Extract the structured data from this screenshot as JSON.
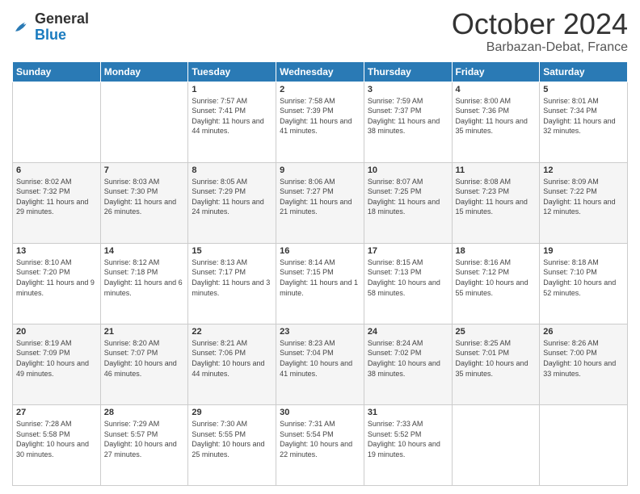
{
  "header": {
    "logo": {
      "general": "General",
      "blue": "Blue"
    },
    "title": "October 2024",
    "location": "Barbazan-Debat, France"
  },
  "weekdays": [
    "Sunday",
    "Monday",
    "Tuesday",
    "Wednesday",
    "Thursday",
    "Friday",
    "Saturday"
  ],
  "weeks": [
    [
      {
        "day": "",
        "sunrise": "",
        "sunset": "",
        "daylight": ""
      },
      {
        "day": "",
        "sunrise": "",
        "sunset": "",
        "daylight": ""
      },
      {
        "day": "1",
        "sunrise": "Sunrise: 7:57 AM",
        "sunset": "Sunset: 7:41 PM",
        "daylight": "Daylight: 11 hours and 44 minutes."
      },
      {
        "day": "2",
        "sunrise": "Sunrise: 7:58 AM",
        "sunset": "Sunset: 7:39 PM",
        "daylight": "Daylight: 11 hours and 41 minutes."
      },
      {
        "day": "3",
        "sunrise": "Sunrise: 7:59 AM",
        "sunset": "Sunset: 7:37 PM",
        "daylight": "Daylight: 11 hours and 38 minutes."
      },
      {
        "day": "4",
        "sunrise": "Sunrise: 8:00 AM",
        "sunset": "Sunset: 7:36 PM",
        "daylight": "Daylight: 11 hours and 35 minutes."
      },
      {
        "day": "5",
        "sunrise": "Sunrise: 8:01 AM",
        "sunset": "Sunset: 7:34 PM",
        "daylight": "Daylight: 11 hours and 32 minutes."
      }
    ],
    [
      {
        "day": "6",
        "sunrise": "Sunrise: 8:02 AM",
        "sunset": "Sunset: 7:32 PM",
        "daylight": "Daylight: 11 hours and 29 minutes."
      },
      {
        "day": "7",
        "sunrise": "Sunrise: 8:03 AM",
        "sunset": "Sunset: 7:30 PM",
        "daylight": "Daylight: 11 hours and 26 minutes."
      },
      {
        "day": "8",
        "sunrise": "Sunrise: 8:05 AM",
        "sunset": "Sunset: 7:29 PM",
        "daylight": "Daylight: 11 hours and 24 minutes."
      },
      {
        "day": "9",
        "sunrise": "Sunrise: 8:06 AM",
        "sunset": "Sunset: 7:27 PM",
        "daylight": "Daylight: 11 hours and 21 minutes."
      },
      {
        "day": "10",
        "sunrise": "Sunrise: 8:07 AM",
        "sunset": "Sunset: 7:25 PM",
        "daylight": "Daylight: 11 hours and 18 minutes."
      },
      {
        "day": "11",
        "sunrise": "Sunrise: 8:08 AM",
        "sunset": "Sunset: 7:23 PM",
        "daylight": "Daylight: 11 hours and 15 minutes."
      },
      {
        "day": "12",
        "sunrise": "Sunrise: 8:09 AM",
        "sunset": "Sunset: 7:22 PM",
        "daylight": "Daylight: 11 hours and 12 minutes."
      }
    ],
    [
      {
        "day": "13",
        "sunrise": "Sunrise: 8:10 AM",
        "sunset": "Sunset: 7:20 PM",
        "daylight": "Daylight: 11 hours and 9 minutes."
      },
      {
        "day": "14",
        "sunrise": "Sunrise: 8:12 AM",
        "sunset": "Sunset: 7:18 PM",
        "daylight": "Daylight: 11 hours and 6 minutes."
      },
      {
        "day": "15",
        "sunrise": "Sunrise: 8:13 AM",
        "sunset": "Sunset: 7:17 PM",
        "daylight": "Daylight: 11 hours and 3 minutes."
      },
      {
        "day": "16",
        "sunrise": "Sunrise: 8:14 AM",
        "sunset": "Sunset: 7:15 PM",
        "daylight": "Daylight: 11 hours and 1 minute."
      },
      {
        "day": "17",
        "sunrise": "Sunrise: 8:15 AM",
        "sunset": "Sunset: 7:13 PM",
        "daylight": "Daylight: 10 hours and 58 minutes."
      },
      {
        "day": "18",
        "sunrise": "Sunrise: 8:16 AM",
        "sunset": "Sunset: 7:12 PM",
        "daylight": "Daylight: 10 hours and 55 minutes."
      },
      {
        "day": "19",
        "sunrise": "Sunrise: 8:18 AM",
        "sunset": "Sunset: 7:10 PM",
        "daylight": "Daylight: 10 hours and 52 minutes."
      }
    ],
    [
      {
        "day": "20",
        "sunrise": "Sunrise: 8:19 AM",
        "sunset": "Sunset: 7:09 PM",
        "daylight": "Daylight: 10 hours and 49 minutes."
      },
      {
        "day": "21",
        "sunrise": "Sunrise: 8:20 AM",
        "sunset": "Sunset: 7:07 PM",
        "daylight": "Daylight: 10 hours and 46 minutes."
      },
      {
        "day": "22",
        "sunrise": "Sunrise: 8:21 AM",
        "sunset": "Sunset: 7:06 PM",
        "daylight": "Daylight: 10 hours and 44 minutes."
      },
      {
        "day": "23",
        "sunrise": "Sunrise: 8:23 AM",
        "sunset": "Sunset: 7:04 PM",
        "daylight": "Daylight: 10 hours and 41 minutes."
      },
      {
        "day": "24",
        "sunrise": "Sunrise: 8:24 AM",
        "sunset": "Sunset: 7:02 PM",
        "daylight": "Daylight: 10 hours and 38 minutes."
      },
      {
        "day": "25",
        "sunrise": "Sunrise: 8:25 AM",
        "sunset": "Sunset: 7:01 PM",
        "daylight": "Daylight: 10 hours and 35 minutes."
      },
      {
        "day": "26",
        "sunrise": "Sunrise: 8:26 AM",
        "sunset": "Sunset: 7:00 PM",
        "daylight": "Daylight: 10 hours and 33 minutes."
      }
    ],
    [
      {
        "day": "27",
        "sunrise": "Sunrise: 7:28 AM",
        "sunset": "Sunset: 5:58 PM",
        "daylight": "Daylight: 10 hours and 30 minutes."
      },
      {
        "day": "28",
        "sunrise": "Sunrise: 7:29 AM",
        "sunset": "Sunset: 5:57 PM",
        "daylight": "Daylight: 10 hours and 27 minutes."
      },
      {
        "day": "29",
        "sunrise": "Sunrise: 7:30 AM",
        "sunset": "Sunset: 5:55 PM",
        "daylight": "Daylight: 10 hours and 25 minutes."
      },
      {
        "day": "30",
        "sunrise": "Sunrise: 7:31 AM",
        "sunset": "Sunset: 5:54 PM",
        "daylight": "Daylight: 10 hours and 22 minutes."
      },
      {
        "day": "31",
        "sunrise": "Sunrise: 7:33 AM",
        "sunset": "Sunset: 5:52 PM",
        "daylight": "Daylight: 10 hours and 19 minutes."
      },
      {
        "day": "",
        "sunrise": "",
        "sunset": "",
        "daylight": ""
      },
      {
        "day": "",
        "sunrise": "",
        "sunset": "",
        "daylight": ""
      }
    ]
  ]
}
